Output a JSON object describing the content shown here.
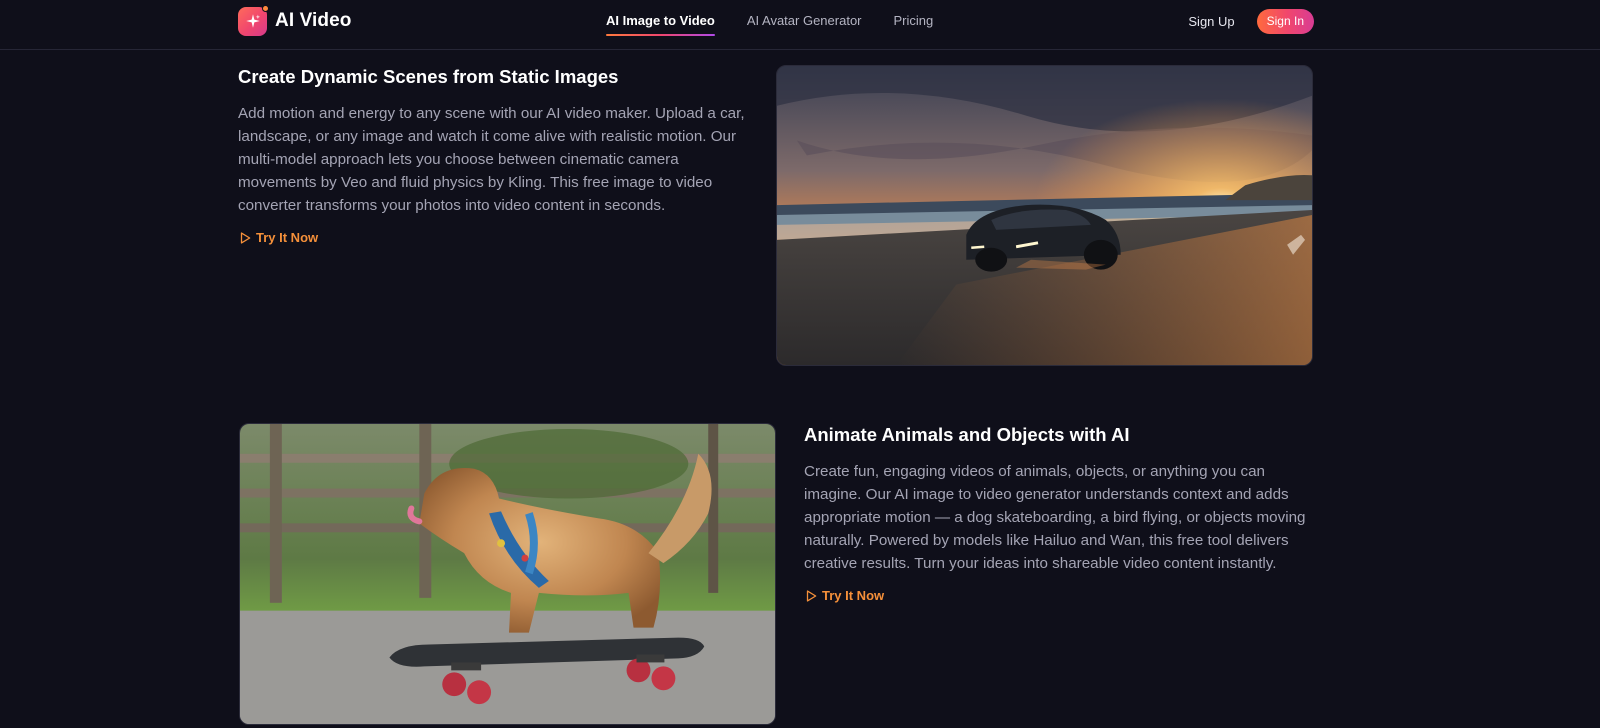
{
  "header": {
    "logo_text": "AI Video",
    "nav": [
      {
        "label": "AI Image to Video",
        "active": true
      },
      {
        "label": "AI Avatar Generator",
        "active": false
      },
      {
        "label": "Pricing",
        "active": false
      }
    ],
    "sign_up_label": "Sign Up",
    "sign_in_label": "Sign In"
  },
  "features": [
    {
      "title": "Create Dynamic Scenes from Static Images",
      "body": "Add motion and energy to any scene with our AI video maker. Upload a car, landscape, or any image and watch it come alive with realistic motion. Our multi-model approach lets you choose between cinematic camera movements by Veo and fluid physics by Kling. This free image to video converter transforms your photos into video content in seconds.",
      "cta_label": "Try It Now"
    },
    {
      "title": "Animate Animals and Objects with AI",
      "body": "Create fun, engaging videos of animals, objects, or anything you can imagine. Our AI image to video generator understands context and adds appropriate motion — a dog skateboarding, a bird flying, or objects moving naturally. Powered by models like Hailuo and Wan, this free tool delivers creative results. Turn your ideas into shareable video content instantly.",
      "cta_label": "Try It Now"
    }
  ],
  "colors": {
    "background": "#0f0f1a",
    "accent_orange": "#f5903a",
    "brand_gradient_start": "#ff6a3d",
    "brand_gradient_end": "#d83c94"
  },
  "icons": {
    "logo": "sparkle-icon",
    "cta": "play-outline-icon"
  }
}
